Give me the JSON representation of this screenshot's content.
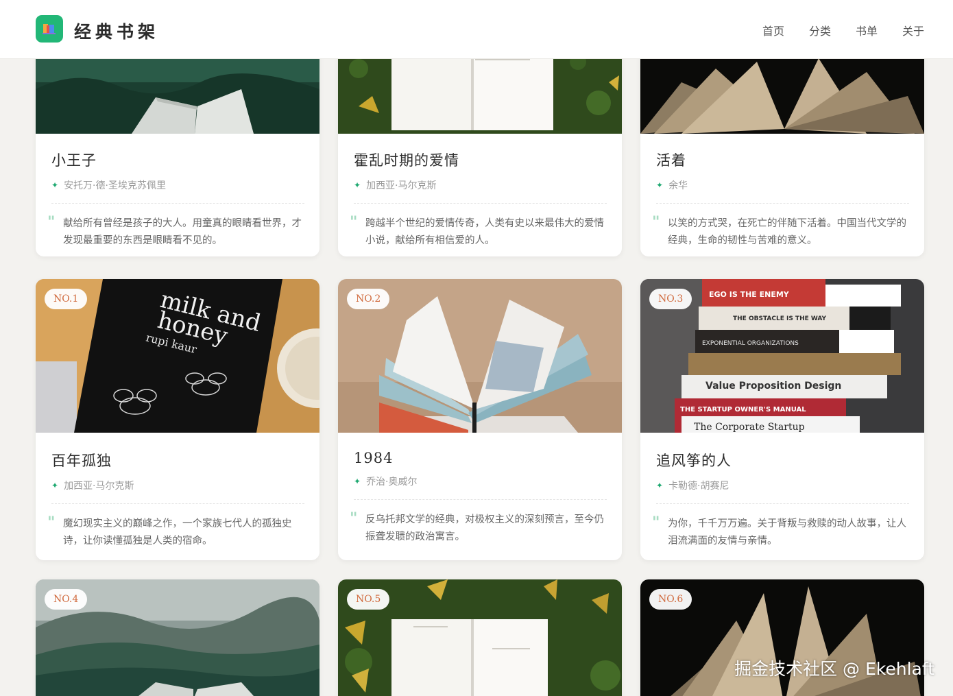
{
  "header": {
    "brand": "经典书架",
    "nav": [
      "首页",
      "分类",
      "书单",
      "关于"
    ]
  },
  "top_cards": [
    {
      "title": "小王子",
      "author": "安托万·德·圣埃克苏佩里",
      "desc": "献给所有曾经是孩子的大人。用童真的眼睛看世界，才发现最重要的东西是眼睛看不见的。"
    },
    {
      "title": "霍乱时期的爱情",
      "author": "加西亚·马尔克斯",
      "desc": "跨越半个世纪的爱情传奇，人类有史以来最伟大的爱情小说，献给所有相信爱的人。"
    },
    {
      "title": "活着",
      "author": "余华",
      "desc": "以笑的方式哭，在死亡的伴随下活着。中国当代文学的经典，生命的韧性与苦难的意义。"
    }
  ],
  "ranked_cards": [
    {
      "rank": "NO.1",
      "title": "百年孤独",
      "author": "加西亚·马尔克斯",
      "desc": "魔幻现实主义的巅峰之作，一个家族七代人的孤独史诗，让你读懂孤独是人类的宿命。",
      "cover_text": [
        "milk and",
        "honey",
        "rupi kaur"
      ]
    },
    {
      "rank": "NO.2",
      "title": "1984",
      "author": "乔治·奥威尔",
      "desc": "反乌托邦文学的经典，对极权主义的深刻预言，至今仍振聋发聩的政治寓言。"
    },
    {
      "rank": "NO.3",
      "title": "追风筝的人",
      "author": "卡勒德·胡赛尼",
      "desc": "为你，千千万万遍。关于背叛与救赎的动人故事，让人泪流满面的友情与亲情。",
      "cover_text": [
        "EGO IS THE ENEMY",
        "THE OBSTACLE IS THE WAY",
        "EXPONENTIAL ORGANIZATIONS",
        "Value Proposition Design",
        "THE STARTUP OWNER'S MANUAL",
        "The Corporate Startup"
      ]
    }
  ],
  "bottom_cards": [
    {
      "rank": "NO.4"
    },
    {
      "rank": "NO.5"
    },
    {
      "rank": "NO.6"
    }
  ],
  "watermark": "掘金技术社区 @ Ekehlaft",
  "colors": {
    "accent": "#22b777",
    "rank": "#d0693c",
    "background": "#f3f2ef"
  }
}
